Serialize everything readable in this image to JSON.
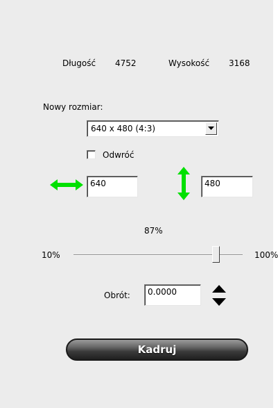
{
  "dimensions": {
    "width_label": "Długość",
    "width_value": "4752",
    "height_label": "Wysokość",
    "height_value": "3168"
  },
  "resize": {
    "label": "Nowy rozmiar:",
    "preset_selected": "640 x 480 (4:3)",
    "invert_label": "Odwróć",
    "invert_checked": false,
    "width_field": "640",
    "height_field": "480"
  },
  "scale": {
    "value_label": "87%",
    "value": 87,
    "min_label": "10%",
    "max_label": "100%"
  },
  "rotation": {
    "label": "Obrót:",
    "value": "0.0000"
  },
  "crop_button": "Kadruj",
  "colors": {
    "arrow_green": "#00e000",
    "panel_bg": "#ececec"
  },
  "icons": {
    "width_arrow": "horizontal-double-arrow-icon",
    "height_arrow": "vertical-double-arrow-icon",
    "dropdown": "chevron-down-icon",
    "rotation_stepper": "up-down-triangles-icon"
  }
}
